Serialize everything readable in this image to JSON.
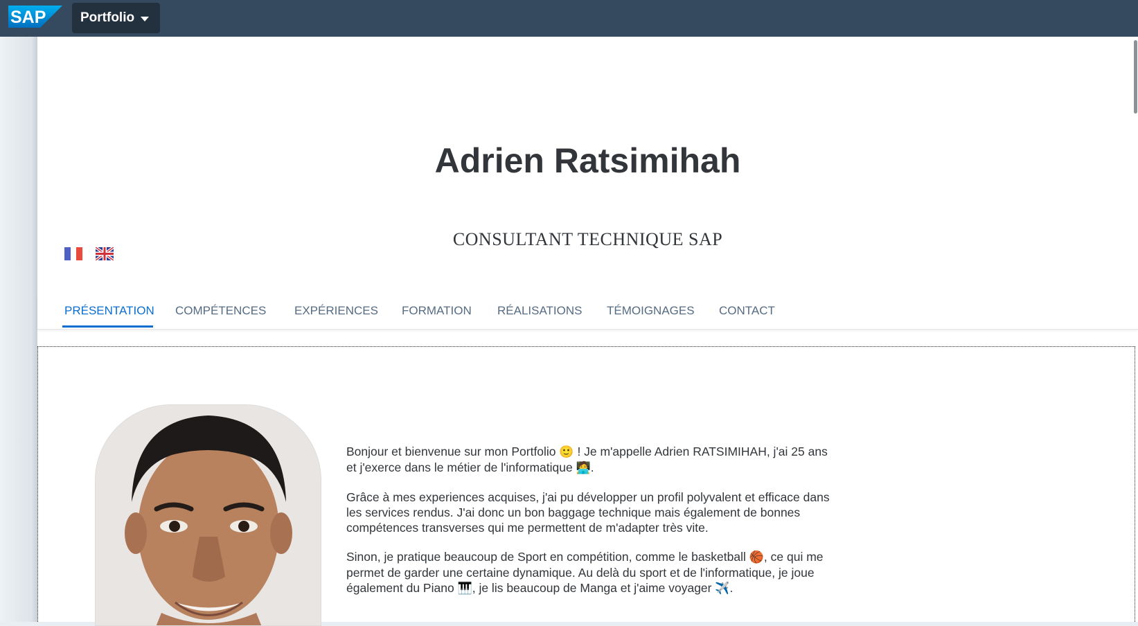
{
  "shellbar": {
    "logo_text": "SAP",
    "app_title": "Portfolio",
    "colors": {
      "background": "#354a5f",
      "title_button": "#23303e",
      "logo": "#0a6ed1"
    }
  },
  "header": {
    "name": "Adrien Ratsimihah",
    "subtitle": "CONSULTANT TECHNIQUE SAP"
  },
  "languages": [
    {
      "icon": "flag-fr-icon"
    },
    {
      "icon": "flag-gb-icon"
    }
  ],
  "tabs": [
    {
      "label": "PRÉSENTATION",
      "active": true
    },
    {
      "label": "COMPÉTENCES",
      "active": false
    },
    {
      "label": "EXPÉRIENCES",
      "active": false
    },
    {
      "label": "FORMATION",
      "active": false
    },
    {
      "label": "RÉALISATIONS",
      "active": false
    },
    {
      "label": "TÉMOIGNAGES",
      "active": false
    },
    {
      "label": "CONTACT",
      "active": false
    }
  ],
  "presentation": {
    "paragraph1": {
      "part1": "Bonjour et bienvenue sur mon Portfolio ",
      "emoji1": "🙂",
      "part2": " ! Je m'appelle Adrien RATSIMIHAH, j'ai 25 ans et j'exerce dans le métier de l'informatique ",
      "emoji2": "🧑‍💻",
      "part3": "."
    },
    "paragraph2": "Grâce à mes experiences acquises, j'ai pu développer un profil polyvalent et efficace dans les services rendus. J'ai donc un bon baggage technique mais également de bonnes compétences transverses qui me permettent de m'adapter très vite.",
    "paragraph3": {
      "part1": "Sinon, je pratique beaucoup de Sport en compétition, comme le basketball ",
      "emoji1": "🏀",
      "part2": ", ce qui me permet de garder une certaine dynamique. Au delà du sport et de l'informatique, je joue également du Piano ",
      "emoji2": "🎹",
      "part3": ", je lis beaucoup de Manga et j'aime voyager ",
      "emoji3": "✈️",
      "part4": "."
    }
  },
  "colors": {
    "accent": "#0a6ed1",
    "tab_text": "#556b82",
    "heading": "#32363a"
  }
}
